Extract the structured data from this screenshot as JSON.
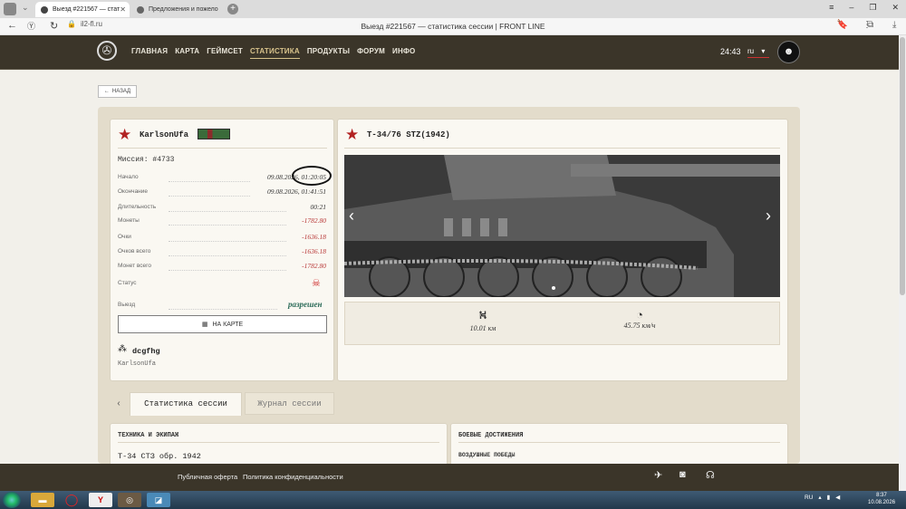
{
  "browser": {
    "tabs": [
      {
        "label": "Выезд #221567 — стат"
      },
      {
        "label": "Предложения и пожело"
      }
    ],
    "url": "il2-fl.ru",
    "page_title": "Выезд #221567 — статистика сессии | FRONT LINE"
  },
  "site": {
    "nav": [
      "ГЛАВНАЯ",
      "КАРТА",
      "ГЕЙМСЕТ",
      "СТАТИСТИКА",
      "ПРОДУКТЫ",
      "ФОРУМ",
      "ИНФО"
    ],
    "active_nav": "СТАТИСТИКА",
    "clock": "24:43",
    "lang": "ru",
    "back_label": "НАЗАД"
  },
  "session": {
    "player": "KarlsonUfa",
    "mission_label": "Миссия:",
    "mission": "#4733",
    "rows": [
      {
        "label": "Начало",
        "value": "09.08.2026, 01:20:05"
      },
      {
        "label": "Окончание",
        "value": "09.08.2026, 01:41:51"
      },
      {
        "label": "Длительность",
        "value": "00:21"
      },
      {
        "label": "Монеты",
        "value": "-1782.80"
      },
      {
        "label": "Очки",
        "value": "-1636.18"
      },
      {
        "label": "Очков всего",
        "value": "-1636.18"
      },
      {
        "label": "Монет всего",
        "value": "-1782.80"
      },
      {
        "label": "Статус",
        "value": ""
      },
      {
        "label": "Выезд",
        "value": "разрешен"
      }
    ],
    "map_button": "НА КАРТЕ",
    "squad": "dcgfhg",
    "squad_member": "KarlsonUfa"
  },
  "vehicle": {
    "name": "T-34/76 STZ(1942)",
    "distance": "10.01 км",
    "speed": "45.75 км/ч"
  },
  "tabs": {
    "stats": "Статистика сессии",
    "log": "Журнал сессии"
  },
  "sections": {
    "tech_title": "ТЕХНИКА И ЭКИПАЖ",
    "tech_vehicle": "T-34 СТЗ обр. 1942",
    "ach_title": "БОЕВЫЕ ДОСТИЖЕНИЯ",
    "air_wins": "ВОЗДУШНЫЕ ПОБЕДЫ"
  },
  "footer": {
    "offer": "Публичная оферта",
    "privacy": "Политика конфиденциальности"
  },
  "taskbar": {
    "lang": "RU",
    "time": "8:37",
    "date": "10.08.2026"
  },
  "colors": {
    "header": "#3b3529",
    "accent": "#d7c28b",
    "negative": "#b73434",
    "star": "#b22222"
  }
}
